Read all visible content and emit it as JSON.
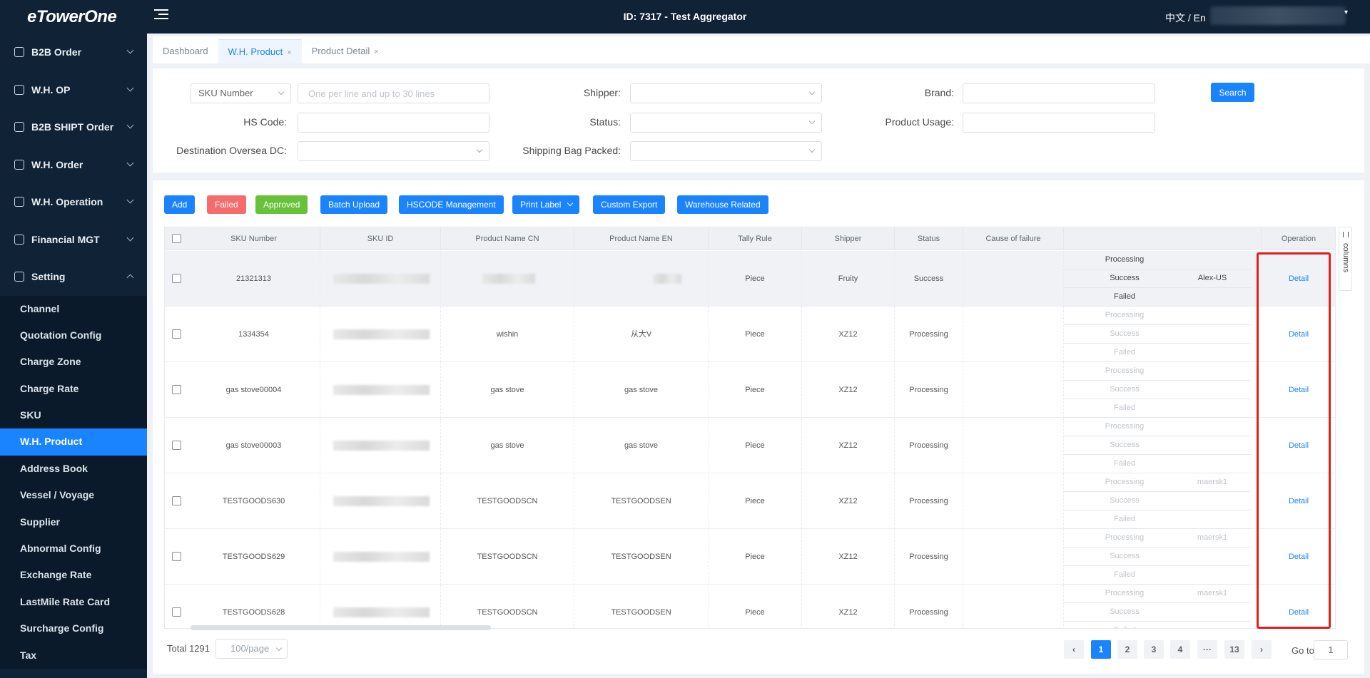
{
  "topbar": {
    "logo": "eTowerOne",
    "title": "ID: 7317 - Test Aggregator",
    "lang": "中文 / En"
  },
  "sidebar": {
    "groups": [
      {
        "label": "B2B Order"
      },
      {
        "label": "W.H. OP"
      },
      {
        "label": "B2B SHIPT Order"
      },
      {
        "label": "W.H. Order"
      },
      {
        "label": "W.H. Operation"
      },
      {
        "label": "Financial MGT"
      },
      {
        "label": "Setting"
      }
    ],
    "setting_items": [
      {
        "label": "Channel"
      },
      {
        "label": "Quotation Config"
      },
      {
        "label": "Charge Zone"
      },
      {
        "label": "Charge Rate"
      },
      {
        "label": "SKU"
      },
      {
        "label": "W.H. Product"
      },
      {
        "label": "Address Book"
      },
      {
        "label": "Vessel / Voyage"
      },
      {
        "label": "Supplier"
      },
      {
        "label": "Abnormal Config"
      },
      {
        "label": "Exchange Rate"
      },
      {
        "label": "LastMile Rate Card"
      },
      {
        "label": "Surcharge Config"
      },
      {
        "label": "Tax"
      }
    ]
  },
  "tabs": [
    {
      "label": "Dashboard"
    },
    {
      "label": "W.H. Product",
      "close": "×"
    },
    {
      "label": "Product Detail",
      "close": "×"
    }
  ],
  "filters": {
    "sku_select": "SKU Number",
    "sku_placeholder": "One per line and up to 30 lines",
    "shipper_label": "Shipper:",
    "brand_label": "Brand:",
    "search_btn": "Search",
    "hs_code_label": "HS Code:",
    "status_label": "Status:",
    "product_usage_label": "Product Usage:",
    "dest_label": "Destination Oversea DC:",
    "bag_label": "Shipping Bag Packed:"
  },
  "toolbar": {
    "add": "Add",
    "failed": "Failed",
    "approved": "Approved",
    "batch_upload": "Batch Upload",
    "hscode": "HSCODE Management",
    "print_label": "Print Label",
    "custom_export": "Custom Export",
    "warehouse_related": "Warehouse Related"
  },
  "table": {
    "headers": [
      "SKU Number",
      "SKU ID",
      "Product Name CN",
      "Product Name EN",
      "Tally Rule",
      "Shipper",
      "Status",
      "Cause of failure",
      "",
      "Operation"
    ],
    "status_stack_labels": [
      "Processing",
      "Success",
      "Failed"
    ],
    "rows": [
      {
        "sku": "21321313",
        "name_cn": "",
        "name_en": "",
        "tally": "Piece",
        "shipper": "Fruity",
        "status": "Success",
        "ss_ship": [
          "",
          "Alex-US",
          ""
        ],
        "op": "Detail"
      },
      {
        "sku": "1334354",
        "name_cn": "wishin",
        "name_en": "从大V",
        "tally": "Piece",
        "shipper": "XZ12",
        "status": "Processing",
        "ss_ship": [
          "",
          "",
          ""
        ],
        "op": "Detail"
      },
      {
        "sku": "gas stove00004",
        "name_cn": "gas stove",
        "name_en": "gas stove",
        "tally": "Piece",
        "shipper": "XZ12",
        "status": "Processing",
        "ss_ship": [
          "",
          "",
          ""
        ],
        "op": "Detail"
      },
      {
        "sku": "gas stove00003",
        "name_cn": "gas stove",
        "name_en": "gas stove",
        "tally": "Piece",
        "shipper": "XZ12",
        "status": "Processing",
        "ss_ship": [
          "",
          "",
          ""
        ],
        "op": "Detail"
      },
      {
        "sku": "TESTGOODS630",
        "name_cn": "TESTGOODSCN",
        "name_en": "TESTGOODSEN",
        "tally": "Piece",
        "shipper": "XZ12",
        "status": "Processing",
        "ss_ship": [
          "maersk1",
          "",
          ""
        ],
        "op": "Detail"
      },
      {
        "sku": "TESTGOODS629",
        "name_cn": "TESTGOODSCN",
        "name_en": "TESTGOODSEN",
        "tally": "Piece",
        "shipper": "XZ12",
        "status": "Processing",
        "ss_ship": [
          "maersk1",
          "",
          ""
        ],
        "op": "Detail"
      },
      {
        "sku": "TESTGOODS628",
        "name_cn": "TESTGOODSCN",
        "name_en": "TESTGOODSEN",
        "tally": "Piece",
        "shipper": "XZ12",
        "status": "Processing",
        "ss_ship": [
          "maersk1",
          "",
          ""
        ],
        "op": "Detail"
      }
    ]
  },
  "columns_toggle": "columns",
  "pagination": {
    "total": "Total 1291",
    "per_page": "100/page",
    "prev": "‹",
    "pages": [
      "1",
      "2",
      "3",
      "4",
      "···",
      "13"
    ],
    "next": "›",
    "goto_label": "Go to",
    "goto_value": "1"
  }
}
